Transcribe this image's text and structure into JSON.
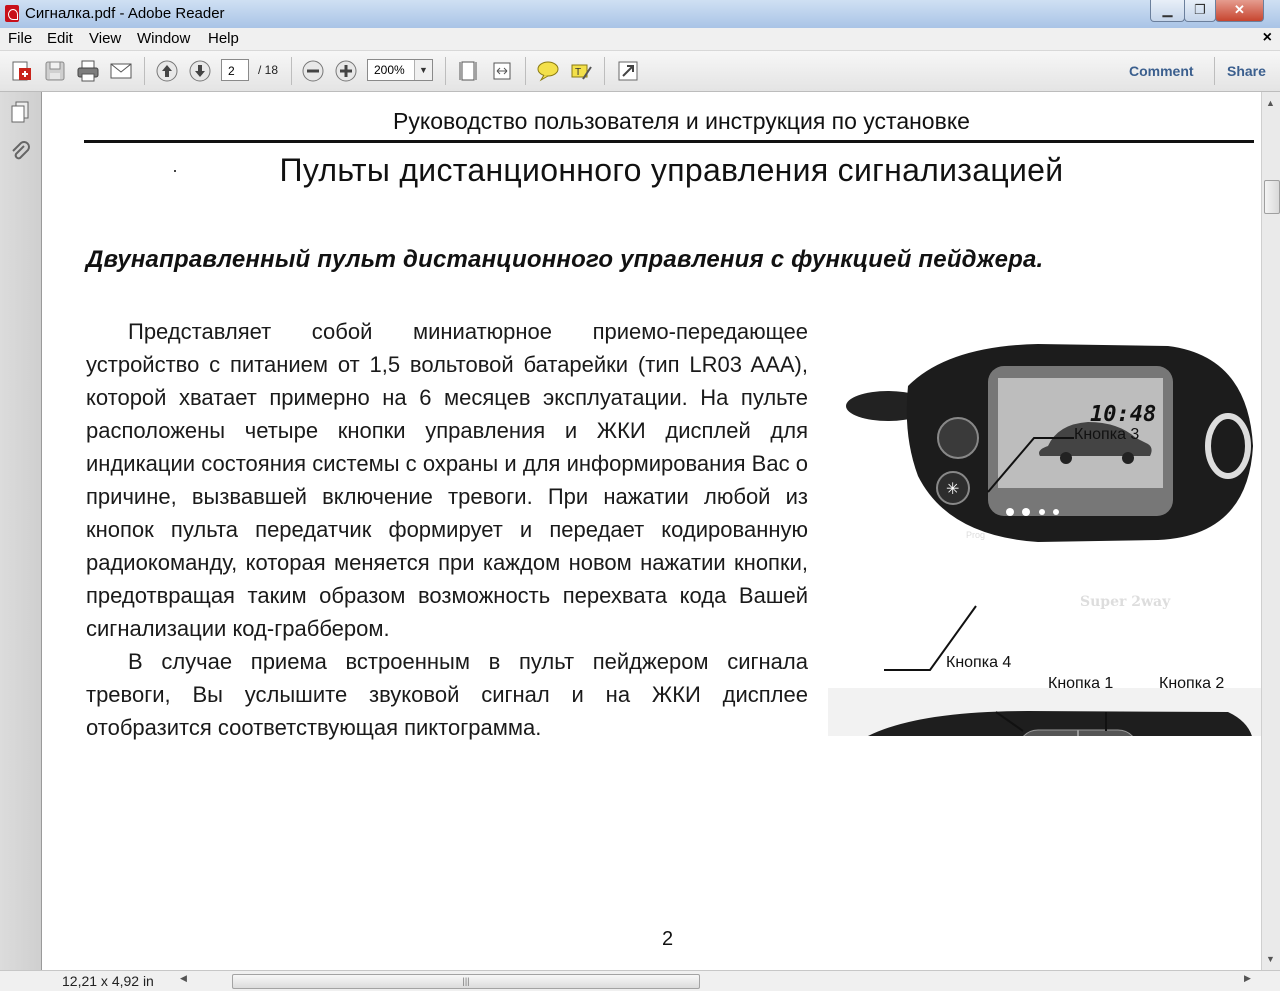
{
  "window": {
    "title": "Сигналка.pdf - Adobe Reader",
    "controls": {
      "minimize": "▁",
      "maximize": "❐",
      "close": "✕"
    }
  },
  "menu": {
    "items": [
      "File",
      "Edit",
      "View",
      "Window",
      "Help"
    ],
    "close_glyph": "×"
  },
  "toolbar": {
    "page_current": "2",
    "page_total": "/ 18",
    "zoom": "200%",
    "comment_label": "Comment",
    "share_label": "Share",
    "icons": [
      "create-pdf-icon",
      "save-icon",
      "print-icon",
      "email-icon",
      "prev-page-icon",
      "next-page-icon",
      "zoom-out-icon",
      "zoom-in-icon",
      "fit-page-icon",
      "fit-width-icon",
      "sticky-note-icon",
      "highlight-icon",
      "expand-icon"
    ]
  },
  "nav": {
    "icons": [
      "pages-icon",
      "attachments-icon"
    ]
  },
  "document": {
    "header": "Руководство пользователя и инструкция по установке",
    "title": "Пульты дистанционного управления сигнализацией",
    "section_heading": "Двунаправленный пульт дистанционного управления с функцией пейджера.",
    "paragraphs": [
      "Представляет собой миниатюрное приемо-передающее устройство с питанием от 1,5 вольтовой батарейки (тип LR03 AAA), которой хватает примерно на 6 месяцев эксплуатации. На пульте расположены четыре кнопки управления и ЖКИ дисплей для индикации состояния системы с охраны и для информирования Вас о причине, вызвавшей включение тревоги. При нажатии любой из кнопок пульта передатчик формирует и передает кодированную радиокоманду, которая меняется при каждом новом нажатии кнопки, предотвращая таким образом возможность перехвата кода Вашей сигнализации код-граббером.",
      "В случае приема встроенным в пульт пейджером сигнала тревоги, Вы услышите звуковой сигнал и на ЖКИ дисплее отобразится соответствующая пиктограмма."
    ],
    "figure": {
      "callouts": {
        "button3": "Кнопка 3",
        "button4": "Кнопка 4",
        "button1": "Кнопка 1",
        "button2": "Кнопка 2"
      },
      "lcd_time": "10:48",
      "brand": "Super 2way",
      "prog_label": "Prog"
    },
    "page_number": "2"
  },
  "status": {
    "page_size": "12,21 x 4,92 in"
  },
  "colors": {
    "link": "#3b5f8e",
    "titlebar": "#b9cfea",
    "navpane": "#d6d6d6"
  }
}
